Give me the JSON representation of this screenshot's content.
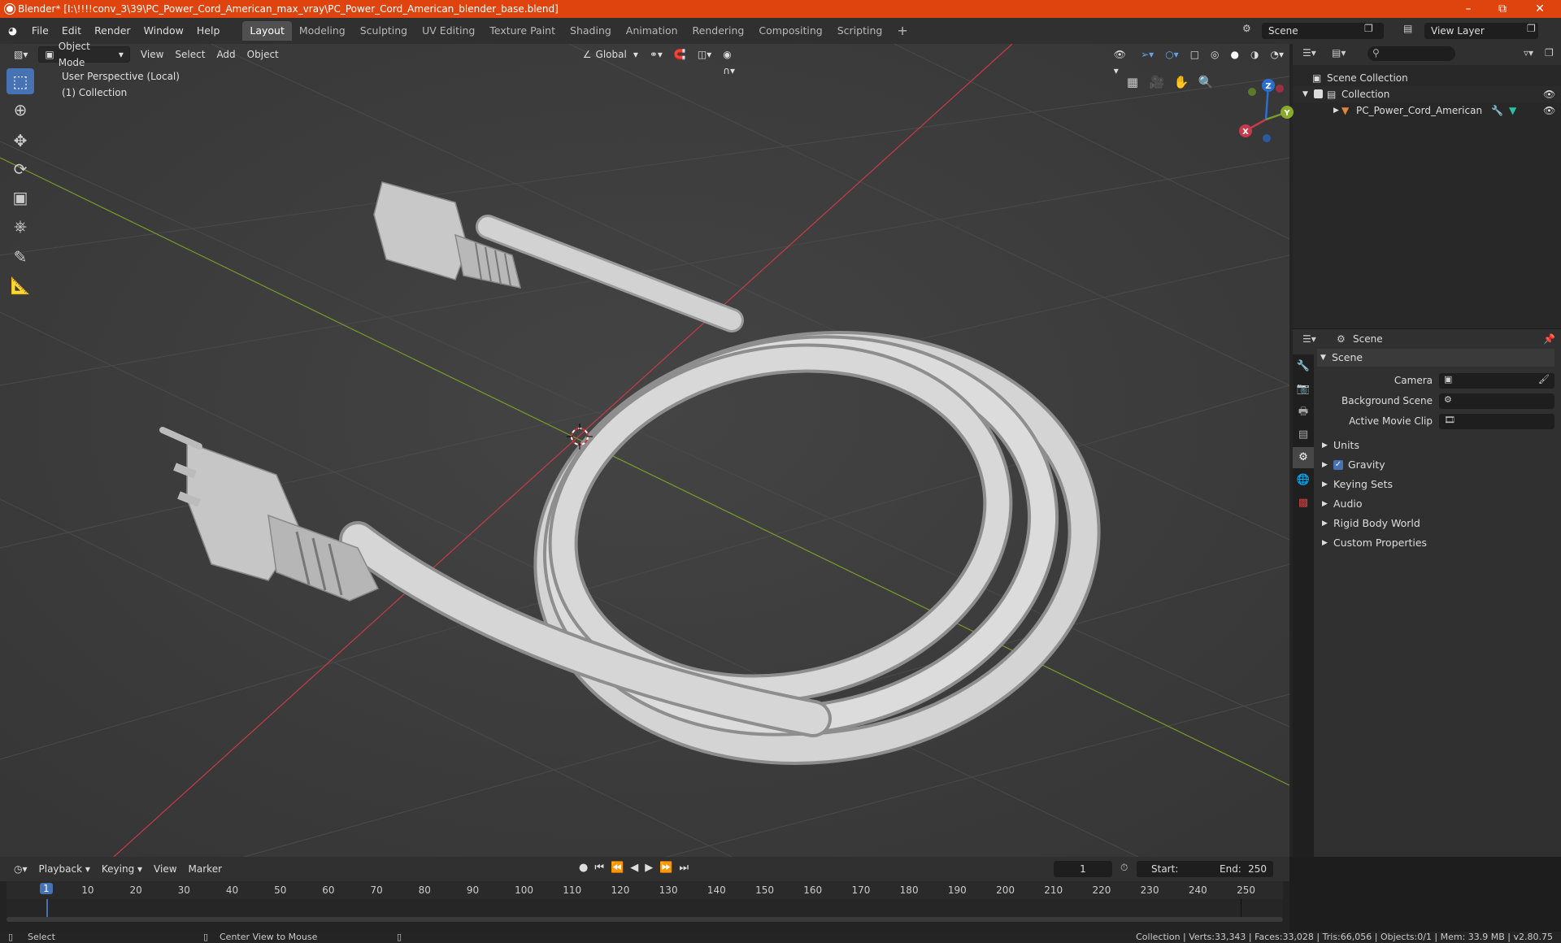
{
  "window": {
    "title": "Blender* [I:\\!!!!conv_3\\39\\PC_Power_Cord_American_max_vray\\PC_Power_Cord_American_blender_base.blend]"
  },
  "menus": [
    "File",
    "Edit",
    "Render",
    "Window",
    "Help"
  ],
  "workspaces": [
    "Layout",
    "Modeling",
    "Sculpting",
    "UV Editing",
    "Texture Paint",
    "Shading",
    "Animation",
    "Rendering",
    "Compositing",
    "Scripting"
  ],
  "active_workspace": "Layout",
  "scene_field": "Scene",
  "view_layer_field": "View Layer",
  "viewport": {
    "mode": "Object Mode",
    "menus": [
      "View",
      "Select",
      "Add",
      "Object"
    ],
    "transform_orientation": "Global",
    "overlay_lines": [
      "User Perspective (Local)",
      "(1) Collection"
    ],
    "gizmo_axes": {
      "x": "X",
      "y": "Y",
      "z": "Z"
    },
    "colors": {
      "x_axis": "#c83a4a",
      "y_axis": "#7a9a2a",
      "z_axis": "#2a6fd0",
      "grid_bg": "#3d3d3d"
    }
  },
  "outliner": {
    "root": "Scene Collection",
    "collection": "Collection",
    "object": "PC_Power_Cord_American"
  },
  "properties": {
    "header": "Scene",
    "panel": "Scene",
    "fields": [
      {
        "label": "Camera",
        "icon": "camera-icon"
      },
      {
        "label": "Background Scene",
        "icon": "scene-icon"
      },
      {
        "label": "Active Movie Clip",
        "icon": "clip-icon"
      }
    ],
    "sections": [
      {
        "label": "Units",
        "checkbox": false
      },
      {
        "label": "Gravity",
        "checkbox": true
      },
      {
        "label": "Keying Sets",
        "checkbox": false
      },
      {
        "label": "Audio",
        "checkbox": false
      },
      {
        "label": "Rigid Body World",
        "checkbox": false
      },
      {
        "label": "Custom Properties",
        "checkbox": false
      }
    ]
  },
  "timeline": {
    "menus": [
      "Playback",
      "Keying",
      "View",
      "Marker"
    ],
    "current_frame": "1",
    "start_label": "Start:",
    "start": "1",
    "end_label": "End:",
    "end": "250",
    "ruler": [
      "1",
      "10",
      "20",
      "30",
      "40",
      "50",
      "60",
      "70",
      "80",
      "90",
      "100",
      "110",
      "120",
      "130",
      "140",
      "150",
      "160",
      "170",
      "180",
      "190",
      "200",
      "210",
      "220",
      "230",
      "240",
      "250"
    ]
  },
  "status": {
    "left": "Select",
    "middle": "Center View to Mouse",
    "right": "Collection | Verts:33,343 | Faces:33,028 | Tris:66,056 | Objects:0/1 | Mem: 33.9 MB | v2.80.75"
  }
}
